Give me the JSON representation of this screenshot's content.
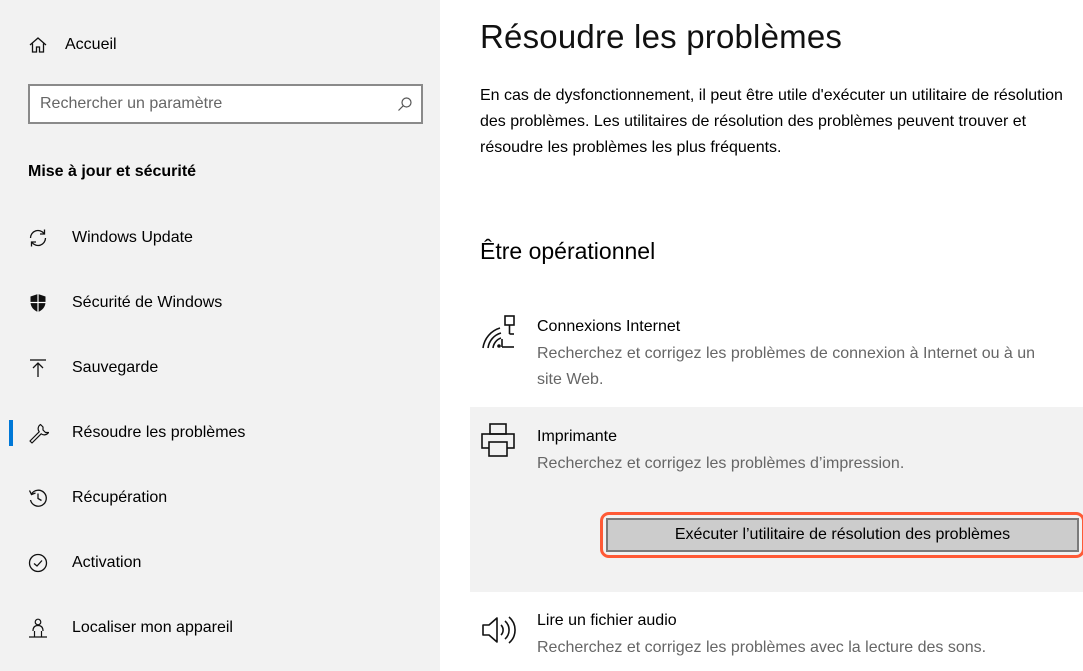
{
  "sidebar": {
    "home": {
      "label": "Accueil",
      "icon": "home-icon"
    },
    "search": {
      "placeholder": "Rechercher un paramètre",
      "icon": "search-icon"
    },
    "section_title": "Mise à jour et sécurité",
    "items": [
      {
        "label": "Windows Update",
        "icon": "sync-icon",
        "active": false
      },
      {
        "label": "Sécurité de Windows",
        "icon": "shield-icon",
        "active": false
      },
      {
        "label": "Sauvegarde",
        "icon": "upload-icon",
        "active": false
      },
      {
        "label": "Résoudre les problèmes",
        "icon": "wrench-icon",
        "active": true
      },
      {
        "label": "Récupération",
        "icon": "history-icon",
        "active": false
      },
      {
        "label": "Activation",
        "icon": "check-circle-icon",
        "active": false
      },
      {
        "label": "Localiser mon appareil",
        "icon": "person-pin-icon",
        "active": false
      }
    ]
  },
  "main": {
    "title": "Résoudre les problèmes",
    "description": "En cas de dysfonctionnement, il peut être utile d'exécuter un utilitaire de résolution des problèmes. Les utilitaires de résolution des problèmes peuvent trouver et résoudre les problèmes les plus fréquents.",
    "section_title": "Être opérationnel",
    "troubleshooters": [
      {
        "name": "Connexions Internet",
        "description": "Recherchez et corrigez les problèmes de connexion à Internet ou à un site Web.",
        "icon": "wifi-network-icon"
      },
      {
        "name": "Imprimante",
        "description": "Recherchez et corrigez les problèmes d’impression.",
        "icon": "printer-icon",
        "selected": true,
        "run_button_label": "Exécuter l’utilitaire de résolution des problèmes"
      },
      {
        "name": "Lire un fichier audio",
        "description": "Recherchez et corrigez les problèmes avec la lecture des sons.",
        "icon": "speaker-icon"
      }
    ]
  },
  "colors": {
    "accent": "#0078d7",
    "highlight": "#ff5a36",
    "sidebar_bg": "#f2f2f2"
  }
}
